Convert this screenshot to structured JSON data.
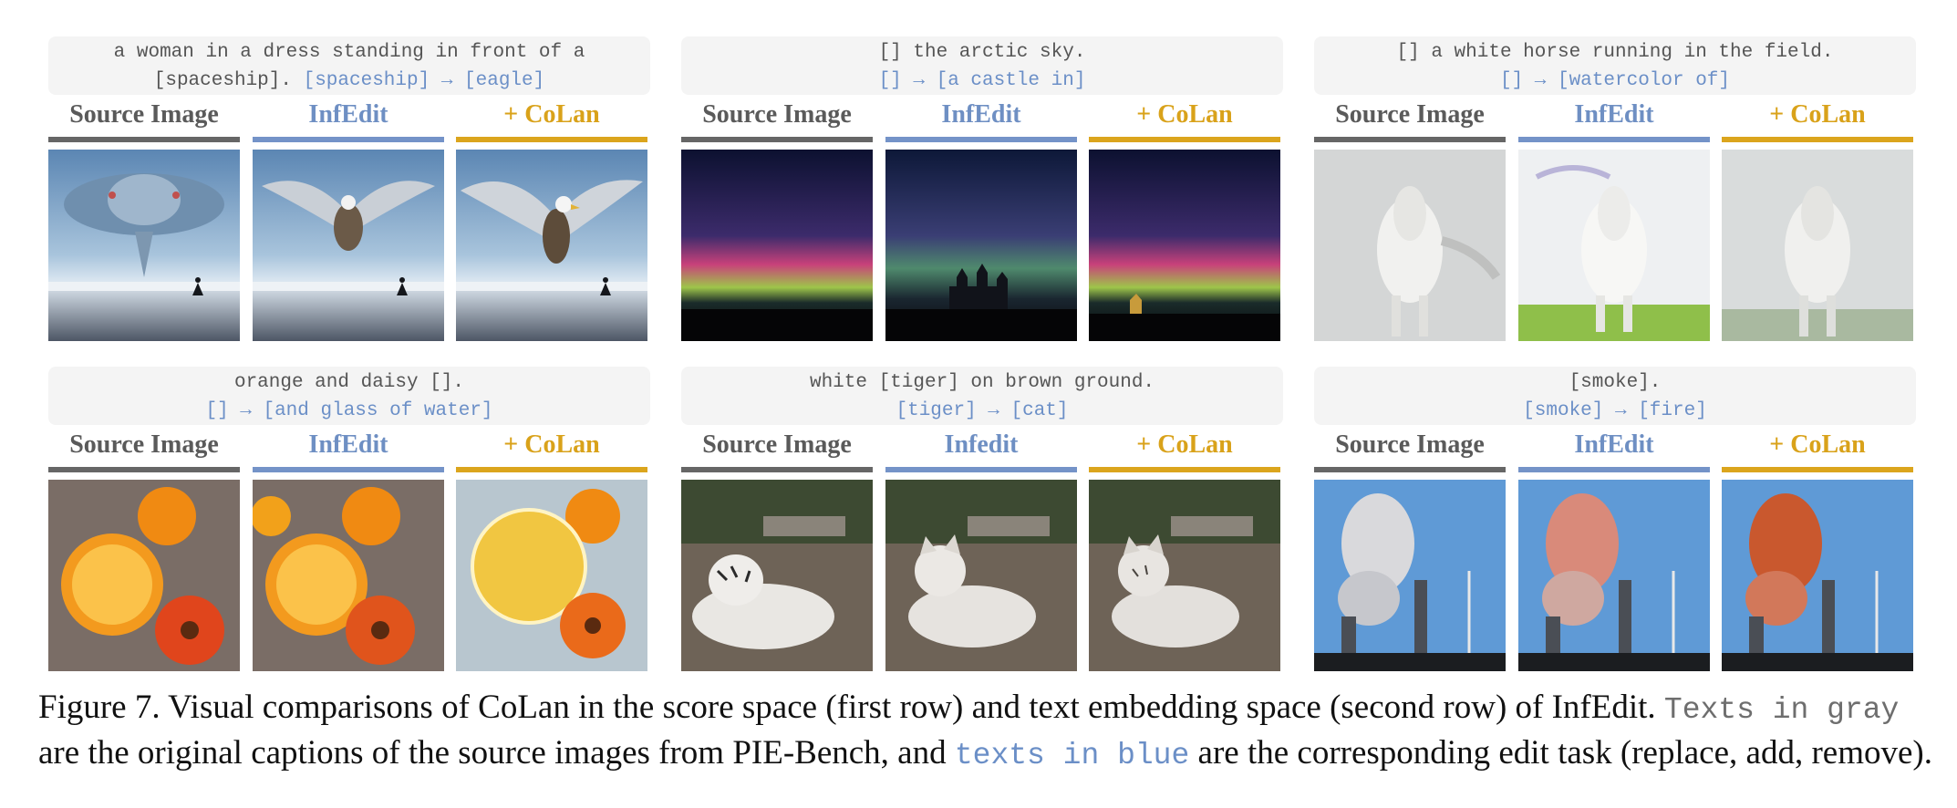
{
  "labels": {
    "source": "Source Image",
    "infedit": "InfEdit",
    "infedit_alt": "Infedit",
    "colan": "+ CoLan"
  },
  "panels": [
    {
      "caption_gray_1": "a woman in a dress standing in front of a",
      "caption_gray_2": "[spaceship].",
      "caption_blue": "[spaceship] → [eagle]",
      "col2_label": "InfEdit"
    },
    {
      "caption_gray_1": "[] the arctic sky.",
      "caption_blue": "[] → [a castle in]",
      "col2_label": "InfEdit"
    },
    {
      "caption_gray_1": "[] a white horse running in the field.",
      "caption_blue": "[] → [watercolor of]",
      "col2_label": "InfEdit"
    },
    {
      "caption_gray_1": "orange and daisy [].",
      "caption_blue": "[] → [and glass of water]",
      "col2_label": "InfEdit"
    },
    {
      "caption_gray_1": "white [tiger] on brown ground.",
      "caption_blue": "[tiger] → [cat]",
      "col2_label": "Infedit"
    },
    {
      "caption_gray_1": "[smoke].",
      "caption_blue": "[smoke] → [fire]",
      "col2_label": "InfEdit"
    }
  ],
  "figure_caption": {
    "part1": "Figure 7. Visual comparisons of CoLan in the score space (first row) and text embedding space (second row) of InfEdit.",
    "gray_term": "Texts in gray",
    "part2": "are the original captions of the source images from PIE-Bench, and",
    "blue_term": "texts in blue",
    "part3": "are the corresponding edit task (replace, add, remove)."
  },
  "colors": {
    "source": "#666666",
    "infedit": "#7493c8",
    "colan": "#dba51d",
    "caption_bg": "#f4f4f4"
  },
  "images": [
    [
      "spaceship-over-sea-photo",
      "eagle-over-sea-photo",
      "eagle-over-sea-photo"
    ],
    [
      "aurora-night-sky-photo",
      "castle-under-aurora-photo",
      "castle-under-aurora-photo"
    ],
    [
      "white-horse-running-photo",
      "watercolor-white-horse-photo",
      "watercolor-white-horse-photo"
    ],
    [
      "oranges-and-daisy-photo",
      "oranges-and-daisy-photo",
      "glass-of-water-oranges-photo"
    ],
    [
      "white-tiger-lying-photo",
      "white-cat-lying-photo",
      "white-cat-lying-photo"
    ],
    [
      "power-plant-smoke-photo",
      "power-plant-fire-photo",
      "power-plant-fire-photo"
    ]
  ]
}
